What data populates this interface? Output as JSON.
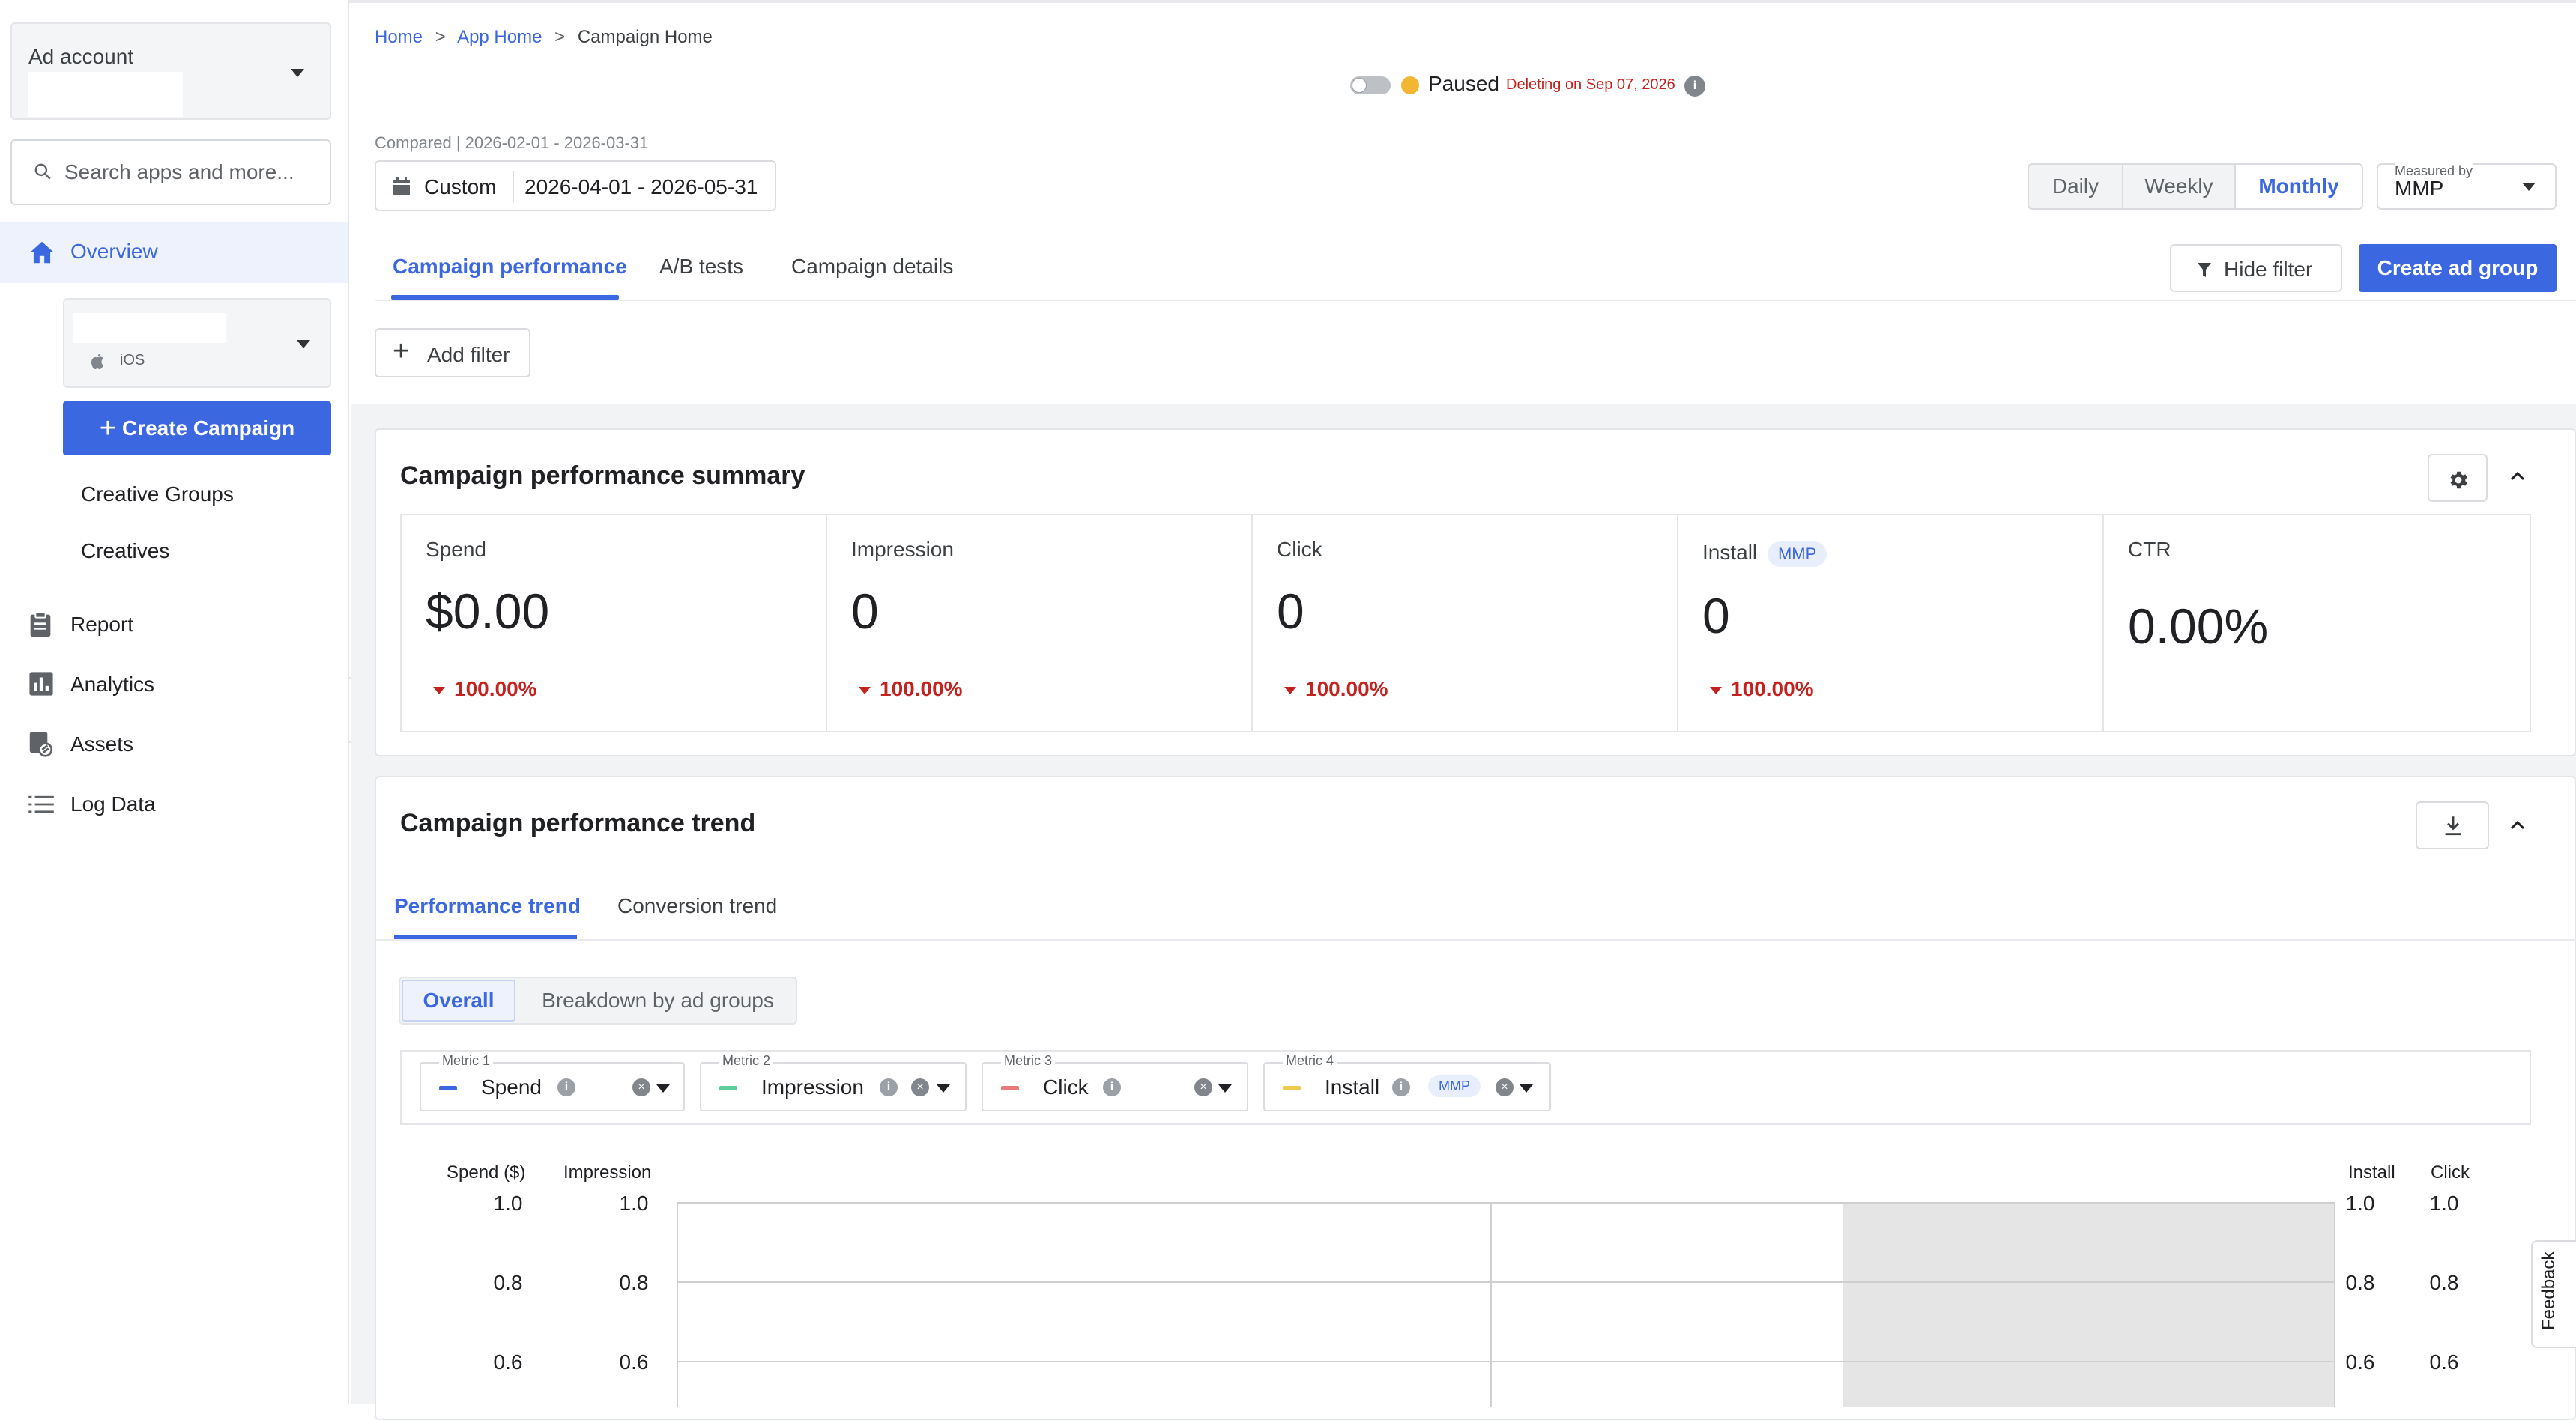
{
  "sidebar": {
    "ad_account_label": "Ad account",
    "search_placeholder": "Search apps and more...",
    "overview_label": "Overview",
    "app_platform": "iOS",
    "create_campaign_label": "Create Campaign",
    "sub_items": [
      {
        "label": "Creative Groups"
      },
      {
        "label": "Creatives"
      }
    ],
    "nav_items": [
      {
        "label": "Report",
        "icon": "clipboard-icon"
      },
      {
        "label": "Analytics",
        "icon": "bar-chart-icon"
      },
      {
        "label": "Assets",
        "icon": "assets-icon"
      },
      {
        "label": "Log Data",
        "icon": "list-icon"
      }
    ]
  },
  "breadcrumb": {
    "items": [
      "Home",
      "App Home",
      "Campaign Home"
    ],
    "separator": ">"
  },
  "status": {
    "label": "Paused",
    "deleting_text": "Deleting on Sep 07, 2026",
    "dot_color": "#f2b632"
  },
  "date": {
    "compared_text": "Compared | 2026-02-01 - 2026-03-31",
    "preset": "Custom",
    "range": "2026-04-01 - 2026-05-31"
  },
  "granularity": {
    "options": [
      "Daily",
      "Weekly",
      "Monthly"
    ],
    "selected": "Monthly"
  },
  "measured_by": {
    "label": "Measured by",
    "value": "MMP"
  },
  "tabs": [
    {
      "label": "Campaign performance",
      "active": true
    },
    {
      "label": "A/B tests",
      "active": false
    },
    {
      "label": "Campaign details",
      "active": false
    }
  ],
  "actions": {
    "hide_filter": "Hide filter",
    "create_ad_group": "Create ad group",
    "add_filter": "Add filter"
  },
  "summary": {
    "title": "Campaign performance summary",
    "metrics": [
      {
        "label": "Spend",
        "value": "$0.00",
        "delta": "100.00%"
      },
      {
        "label": "Impression",
        "value": "0",
        "delta": "100.00%"
      },
      {
        "label": "Click",
        "value": "0",
        "delta": "100.00%"
      },
      {
        "label": "Install",
        "badge": "MMP",
        "value": "0",
        "delta": "100.00%"
      },
      {
        "label": "CTR",
        "value": "0.00%"
      }
    ]
  },
  "trend": {
    "title": "Campaign performance trend",
    "tabs": [
      "Performance trend",
      "Conversion trend"
    ],
    "segments": [
      "Overall",
      "Breakdown by ad groups"
    ],
    "metric_selectors": [
      {
        "caption": "Metric 1",
        "name": "Spend",
        "color": "#3b67e0"
      },
      {
        "caption": "Metric 2",
        "name": "Impression",
        "color": "#5ccf9a"
      },
      {
        "caption": "Metric 3",
        "name": "Click",
        "color": "#e87a7a"
      },
      {
        "caption": "Metric 4",
        "name": "Install",
        "badge": "MMP",
        "color": "#f2c94c"
      }
    ]
  },
  "chart_data": {
    "type": "line",
    "title": "",
    "left_axes": [
      "Spend ($)",
      "Impression"
    ],
    "right_axes": [
      "Install",
      "Click"
    ],
    "y_ticks": [
      "1.0",
      "0.8",
      "0.6"
    ],
    "ylim": [
      0,
      1.0
    ],
    "series": [
      {
        "name": "Spend",
        "values": []
      },
      {
        "name": "Impression",
        "values": []
      },
      {
        "name": "Click",
        "values": []
      },
      {
        "name": "Install",
        "values": []
      }
    ],
    "grid": true
  },
  "feedback_label": "Feedback"
}
